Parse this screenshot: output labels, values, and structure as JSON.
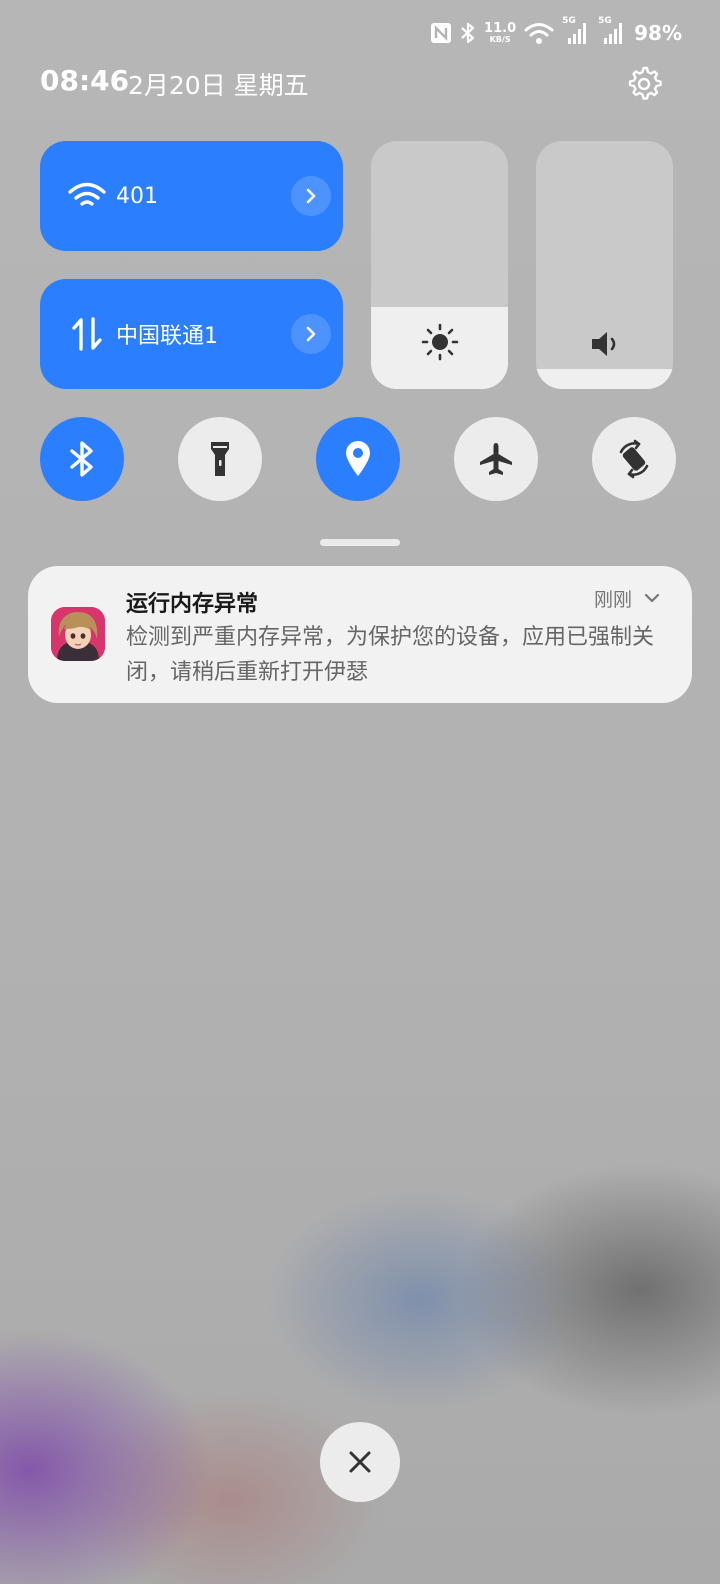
{
  "status_bar": {
    "net_speed_value": "11.0",
    "net_speed_unit": "KB/S",
    "signal1_label": "5G",
    "signal2_label": "5G",
    "battery": "98%",
    "icons": [
      "nfc-icon",
      "bluetooth-icon",
      "wifi-icon",
      "signal-icon",
      "signal-icon"
    ]
  },
  "header": {
    "time": "08:46",
    "date": "2月20日 星期五"
  },
  "tiles": {
    "wifi": {
      "label": "401",
      "icon": "wifi-icon"
    },
    "mobile": {
      "label": "中国联通1",
      "icon": "mobile-data-icon"
    }
  },
  "sliders": {
    "brightness_level": 0.33,
    "volume_level": 0.08
  },
  "toggles": [
    {
      "name": "bluetooth",
      "icon": "bluetooth-icon",
      "on": true
    },
    {
      "name": "flashlight",
      "icon": "flashlight-icon",
      "on": false
    },
    {
      "name": "location",
      "icon": "location-icon",
      "on": true
    },
    {
      "name": "airplane-mode",
      "icon": "airplane-icon",
      "on": false
    },
    {
      "name": "auto-rotate",
      "icon": "rotate-icon",
      "on": false
    }
  ],
  "notification": {
    "title": "运行内存异常",
    "body": "检测到严重内存异常，为保护您的设备，应用已强制关闭，请稍后重新打开伊瑟",
    "time": "刚刚"
  },
  "colors": {
    "accent": "#2b7fff",
    "toggle_off": "#ececec",
    "notification_bg": "#f2f2f2"
  }
}
